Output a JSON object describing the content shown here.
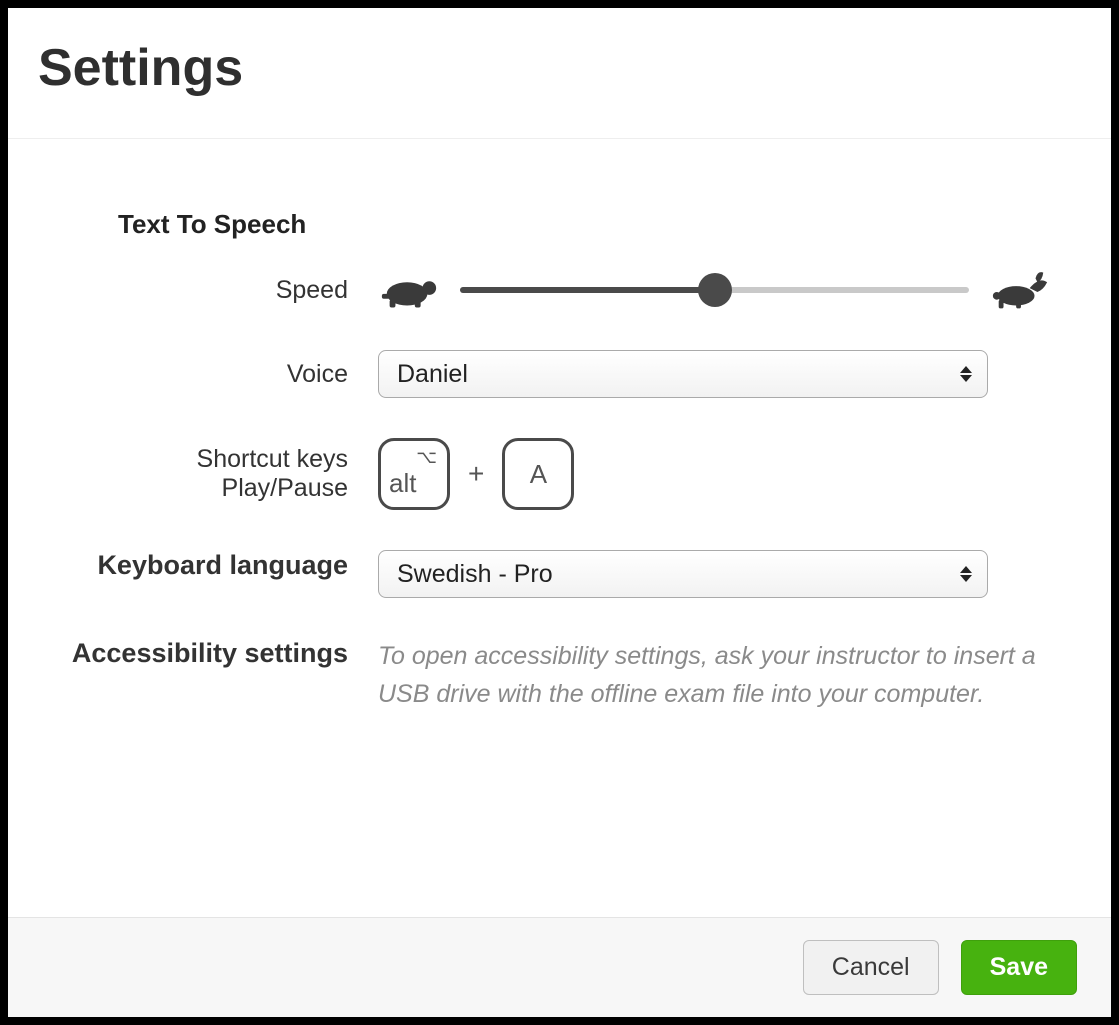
{
  "header": {
    "title": "Settings"
  },
  "tts": {
    "section_label": "Text To Speech",
    "speed": {
      "label": "Speed",
      "value_percent": 50,
      "slow_icon": "turtle-icon",
      "fast_icon": "rabbit-icon"
    },
    "voice": {
      "label": "Voice",
      "selected": "Daniel"
    },
    "shortcut": {
      "label_line1": "Shortcut keys",
      "label_line2": "Play/Pause",
      "keys": {
        "modifier": "alt",
        "modifier_glyph": "⌥",
        "joiner": "+",
        "key": "A"
      }
    }
  },
  "keyboard": {
    "label": "Keyboard language",
    "selected": "Swedish - Pro"
  },
  "accessibility": {
    "label": "Accessibility settings",
    "help": "To open accessibility settings, ask your instructor to insert a USB drive with the offline exam file into your computer."
  },
  "footer": {
    "cancel": "Cancel",
    "save": "Save"
  }
}
